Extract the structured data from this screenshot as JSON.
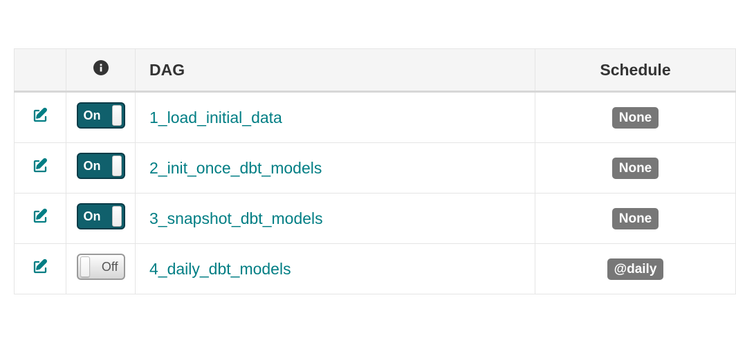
{
  "columns": {
    "dag": "DAG",
    "schedule": "Schedule"
  },
  "toggle_labels": {
    "on": "On",
    "off": "Off"
  },
  "dags": [
    {
      "name": "1_load_initial_data",
      "on": true,
      "schedule": "None"
    },
    {
      "name": "2_init_once_dbt_models",
      "on": true,
      "schedule": "None"
    },
    {
      "name": "3_snapshot_dbt_models",
      "on": true,
      "schedule": "None"
    },
    {
      "name": "4_daily_dbt_models",
      "on": false,
      "schedule": "@daily"
    }
  ]
}
